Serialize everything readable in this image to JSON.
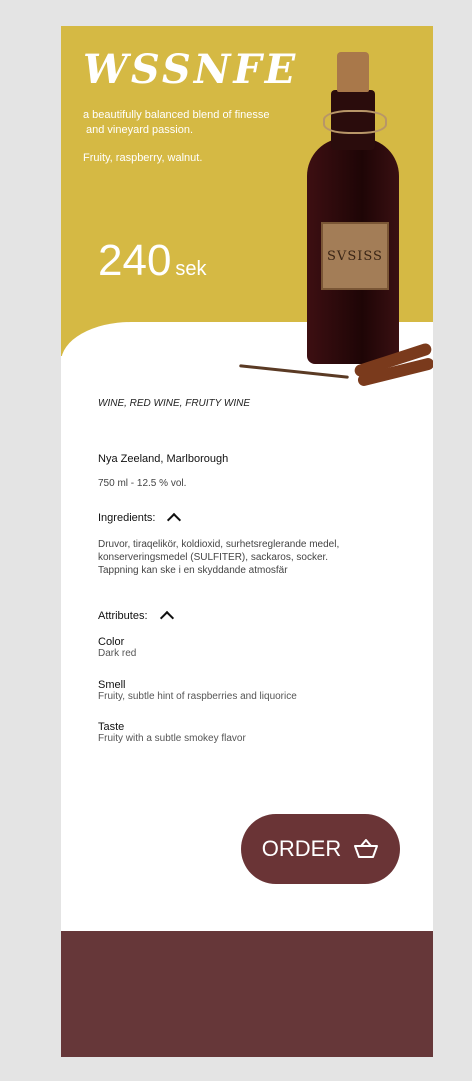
{
  "product": {
    "brand": "WSSNFE",
    "tagline_line1": "a beautifully balanced blend of finesse",
    "tagline_line2": "and vineyard passion.",
    "notes": "Fruity, raspberry, walnut.",
    "price_value": "240",
    "price_currency": "sek",
    "bottle_label": "SVSISS",
    "category": "WINE, RED WINE, FRUITY WINE",
    "region": "Nya Zeeland, Marlborough",
    "volume": "750 ml - 12.5 % vol."
  },
  "ingredients": {
    "title": "Ingredients:",
    "text_line1": "Druvor, tiraqelikör, koldioxid, surhetsreglerande medel,",
    "text_line2": "konserveringsmedel (SULFITER), sackaros, socker.",
    "text_line3": "Tappning kan ske i en skyddande atmosfär"
  },
  "attributes": {
    "title": "Attributes:",
    "items": [
      {
        "name": "Color",
        "value": "Dark red"
      },
      {
        "name": "Smell",
        "value": "Fruity, subtle hint of raspberries and liquorice"
      },
      {
        "name": "Taste",
        "value": "Fruity with a subtle smokey flavor"
      }
    ]
  },
  "actions": {
    "order_label": "ORDER",
    "basket_icon": "basket-icon"
  },
  "colors": {
    "hero": "#d5b944",
    "accent": "#6a3436",
    "footer": "#663739"
  }
}
